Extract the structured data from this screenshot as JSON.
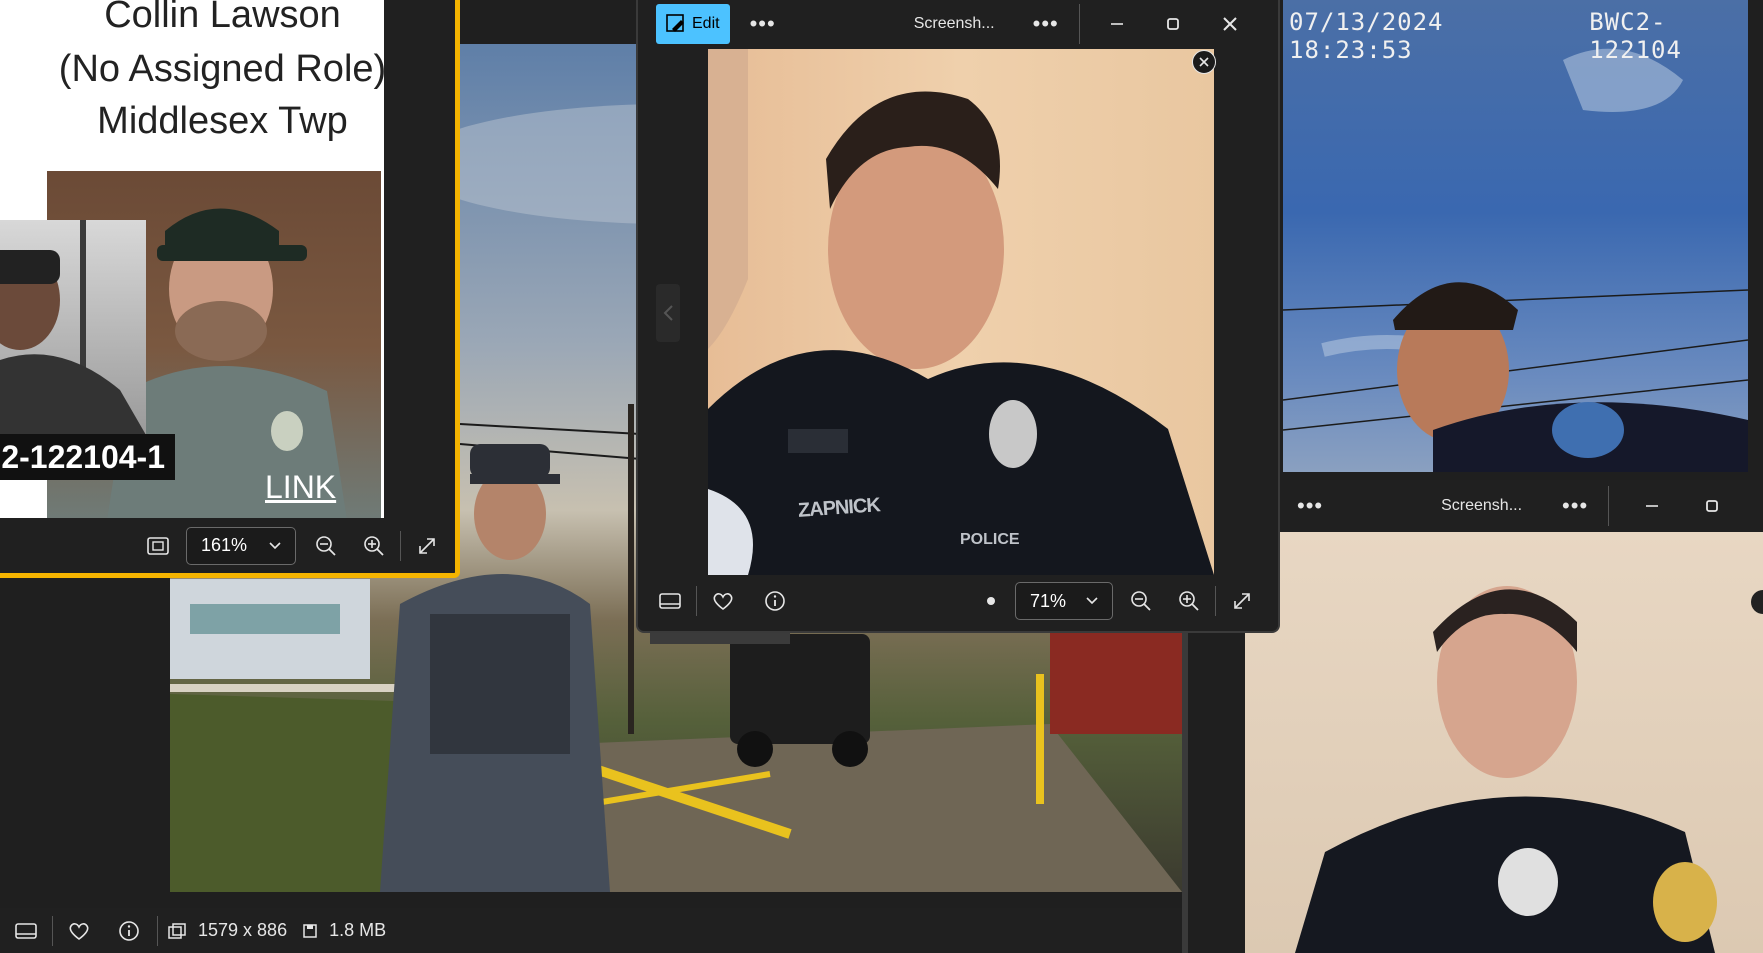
{
  "window_left": {
    "slide_text": {
      "name": "Collin Lawson",
      "role": "(No Assigned Role)",
      "department": "Middlesex Twp"
    },
    "badge_label": "2-122104-1",
    "link_label": "LINK",
    "zoom_value": "161%"
  },
  "window_main": {
    "edit_label": "Edit",
    "title": "Screensh...",
    "zoom_value": "71%",
    "vest_name": "ZAPNICK",
    "patch_text": "POLICE"
  },
  "window_right": {
    "bodycam_timestamp": "07/13/2024 18:23:53",
    "bodycam_id": "BWC2-122104",
    "title": "Screensh..."
  },
  "bottom_bar": {
    "dimensions": "1579 x 886",
    "file_size": "1.8 MB"
  },
  "colors": {
    "accent": "#f5b400",
    "edit_button": "#4cc2ff",
    "chrome": "#202020"
  }
}
